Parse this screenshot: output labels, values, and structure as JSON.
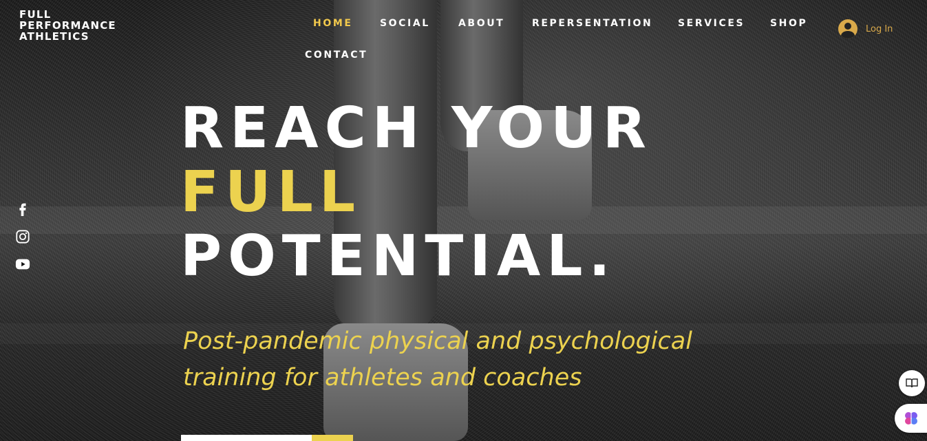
{
  "brand": {
    "line1": "FULL",
    "line2": "PERFORMANCE",
    "line3": "ATHLETICS"
  },
  "nav": {
    "items": [
      {
        "label": "HOME",
        "active": true
      },
      {
        "label": "SOCIAL"
      },
      {
        "label": "ABOUT"
      },
      {
        "label": "REPERSENTATION"
      },
      {
        "label": "SERVICES"
      },
      {
        "label": "SHOP"
      },
      {
        "label": "CONTACT"
      }
    ]
  },
  "login": {
    "label": "Log In",
    "icon": "user-avatar-icon"
  },
  "social": {
    "icons": [
      "facebook-icon",
      "instagram-icon",
      "youtube-icon"
    ]
  },
  "hero": {
    "line1": "REACH YOUR",
    "line2": "FULL",
    "line3": "POTENTIAL.",
    "subtitle_line1": "Post-pandemic physical and psychological",
    "subtitle_line2": "training for athletes and coaches"
  },
  "floating": {
    "reader_icon": "book-icon",
    "assistant_icon": "brain-icon"
  },
  "colors": {
    "accent": "#ECD24F",
    "login": "#D9A94A",
    "text": "#FFFFFF"
  }
}
